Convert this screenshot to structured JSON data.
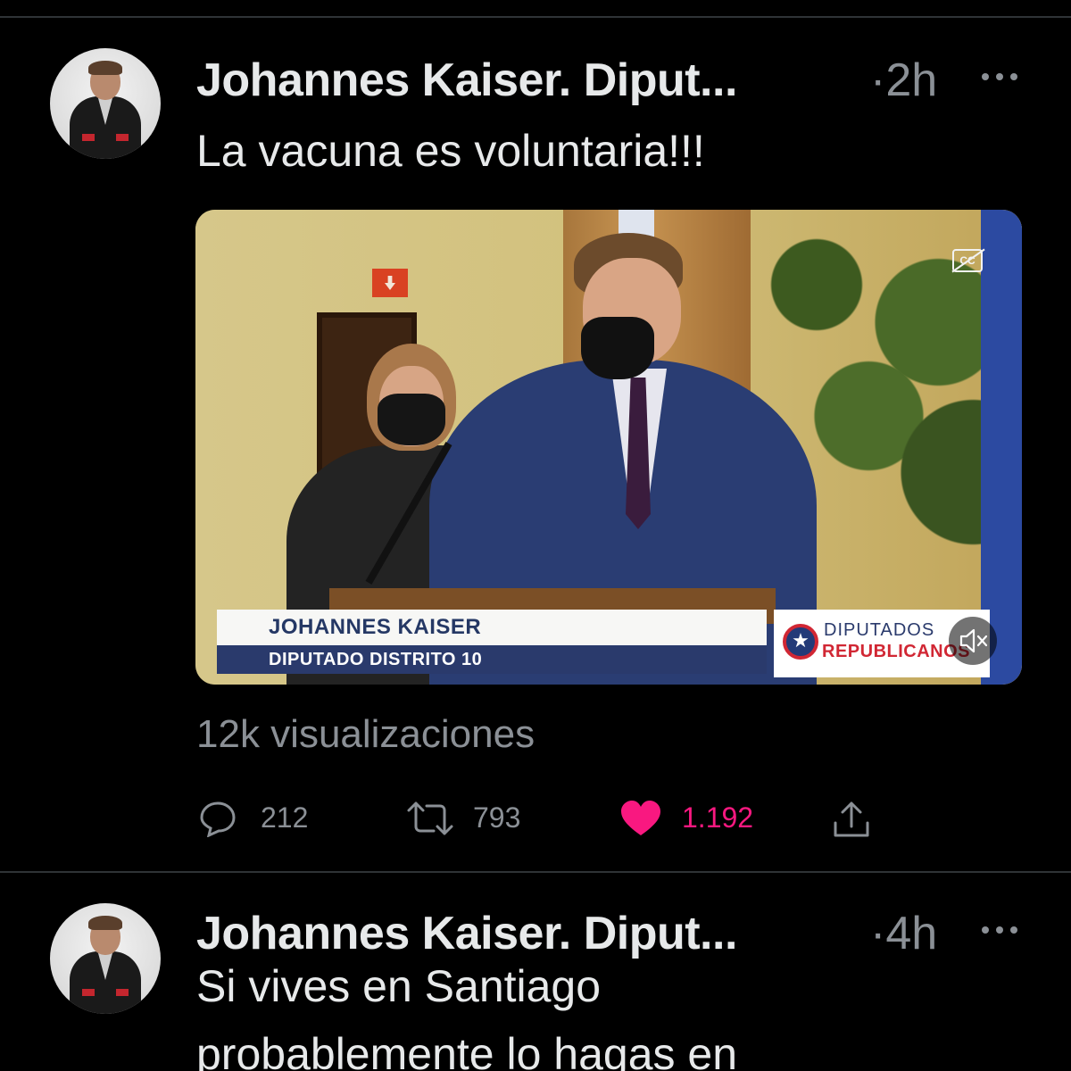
{
  "tweets": [
    {
      "author": "Johannes Kaiser. Diput...",
      "time": "·2h",
      "text": "La vacuna es voluntaria!!!",
      "media": {
        "lower_third_name": "JOHANNES KAISER",
        "lower_third_role": "DIPUTADO DISTRITO 10",
        "logo_line1": "DIPUTADOS",
        "logo_line2": "REPUBLICANOS",
        "cc_label": "CC"
      },
      "views": "12k visualizaciones",
      "actions": {
        "replies": "212",
        "retweets": "793",
        "likes": "1.192"
      }
    },
    {
      "author": "Johannes Kaiser. Diput...",
      "time": "·4h",
      "text_line1": "Si vives en Santiago",
      "text_line2": "probablemente lo hagas en"
    }
  ],
  "colors": {
    "background": "#000000",
    "text": "#e7e9ea",
    "muted": "#8b9096",
    "like": "#f91880",
    "divider": "#2f3336"
  },
  "icons": [
    "more-icon",
    "cc-icon",
    "mute-icon",
    "reply-icon",
    "retweet-icon",
    "heart-icon",
    "share-icon"
  ]
}
